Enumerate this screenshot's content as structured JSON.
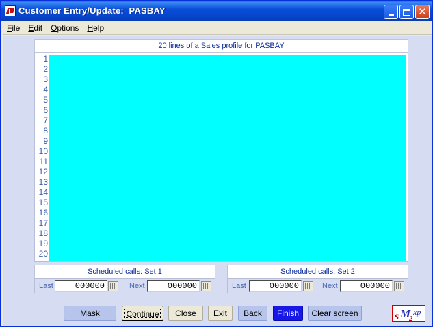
{
  "window": {
    "title": "Customer Entry/Update:  PASBAY"
  },
  "menu": {
    "items": [
      {
        "accel": "F",
        "rest": "ile"
      },
      {
        "accel": "E",
        "rest": "dit"
      },
      {
        "accel": "O",
        "rest": "ptions"
      },
      {
        "accel": "H",
        "rest": "elp"
      }
    ]
  },
  "profile": {
    "header": "20 lines of a Sales profile for PASBAY",
    "line_numbers": [
      "1",
      "2",
      "3",
      "4",
      "5",
      "6",
      "7",
      "8",
      "9",
      "10",
      "11",
      "12",
      "13",
      "14",
      "15",
      "16",
      "17",
      "18",
      "19",
      "20"
    ],
    "text": ""
  },
  "scheduled": {
    "set1": {
      "header": "Scheduled calls: Set 1",
      "last_label": "Last",
      "last_value": "000000",
      "next_label": "Next",
      "next_value": "000000"
    },
    "set2": {
      "header": "Scheduled calls: Set 2",
      "last_label": "Last",
      "last_value": "000000",
      "next_label": "Next",
      "next_value": "000000"
    }
  },
  "buttons": {
    "mask": "Mask",
    "continue": "Continue",
    "close": "Close",
    "exit": "Exit",
    "back": "Back",
    "finish": "Finish",
    "clear": "Clear screen"
  },
  "logo": {
    "text_s": "s",
    "text_m": "M",
    "text_2": "2",
    "text_xp": "xp"
  },
  "colors": {
    "profile_background": "#00ffff",
    "client_background": "#d6dcf2",
    "finish_button": "#1717e8",
    "title_bar": "#0a4fd8"
  }
}
